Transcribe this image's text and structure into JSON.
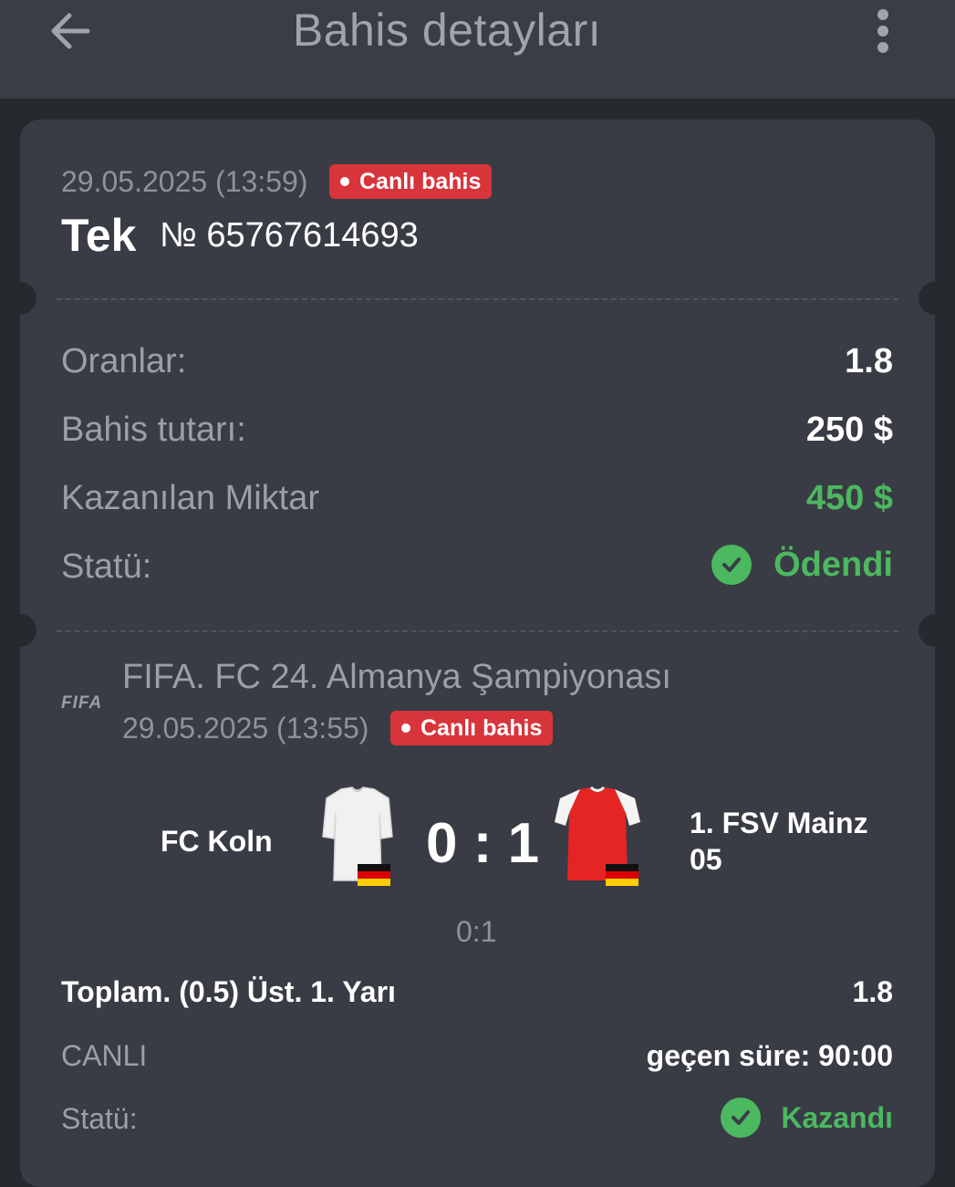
{
  "header": {
    "title": "Bahis detayları",
    "back_icon": "arrow-left-icon",
    "menu_icon": "more-vertical-icon"
  },
  "bet": {
    "date": "29.05.2025 (13:59)",
    "live_badge": "Canlı bahis",
    "type": "Tek",
    "number": "№ 65767614693",
    "rows": {
      "odds_label": "Oranlar:",
      "odds_value": "1.8",
      "stake_label": "Bahis tutarı:",
      "stake_value": "250 $",
      "win_label": "Kazanılan Miktar",
      "win_value": "450 $",
      "status_label": "Statü:",
      "status_value": "Ödendi"
    }
  },
  "event": {
    "logo_text": "FIFA",
    "league": "FIFA. FC 24. Almanya Şampiyonası",
    "date": "29.05.2025 (13:55)",
    "live_badge": "Canlı bahis",
    "home_team": "FC Koln",
    "away_team": "1. FSV Mainz 05",
    "score": "0 : 1",
    "half_score": "0:1",
    "market": "Toplam. (0.5) Üst. 1. Yarı",
    "market_odds": "1.8",
    "live_label": "CANLI",
    "elapsed": "geçen süre: 90:00",
    "status_label": "Statü:",
    "status_value": "Kazandı"
  },
  "colors": {
    "accent_red": "#d8343b",
    "win_green": "#4cb860",
    "card_bg": "#393c45",
    "page_bg": "#26292e"
  }
}
